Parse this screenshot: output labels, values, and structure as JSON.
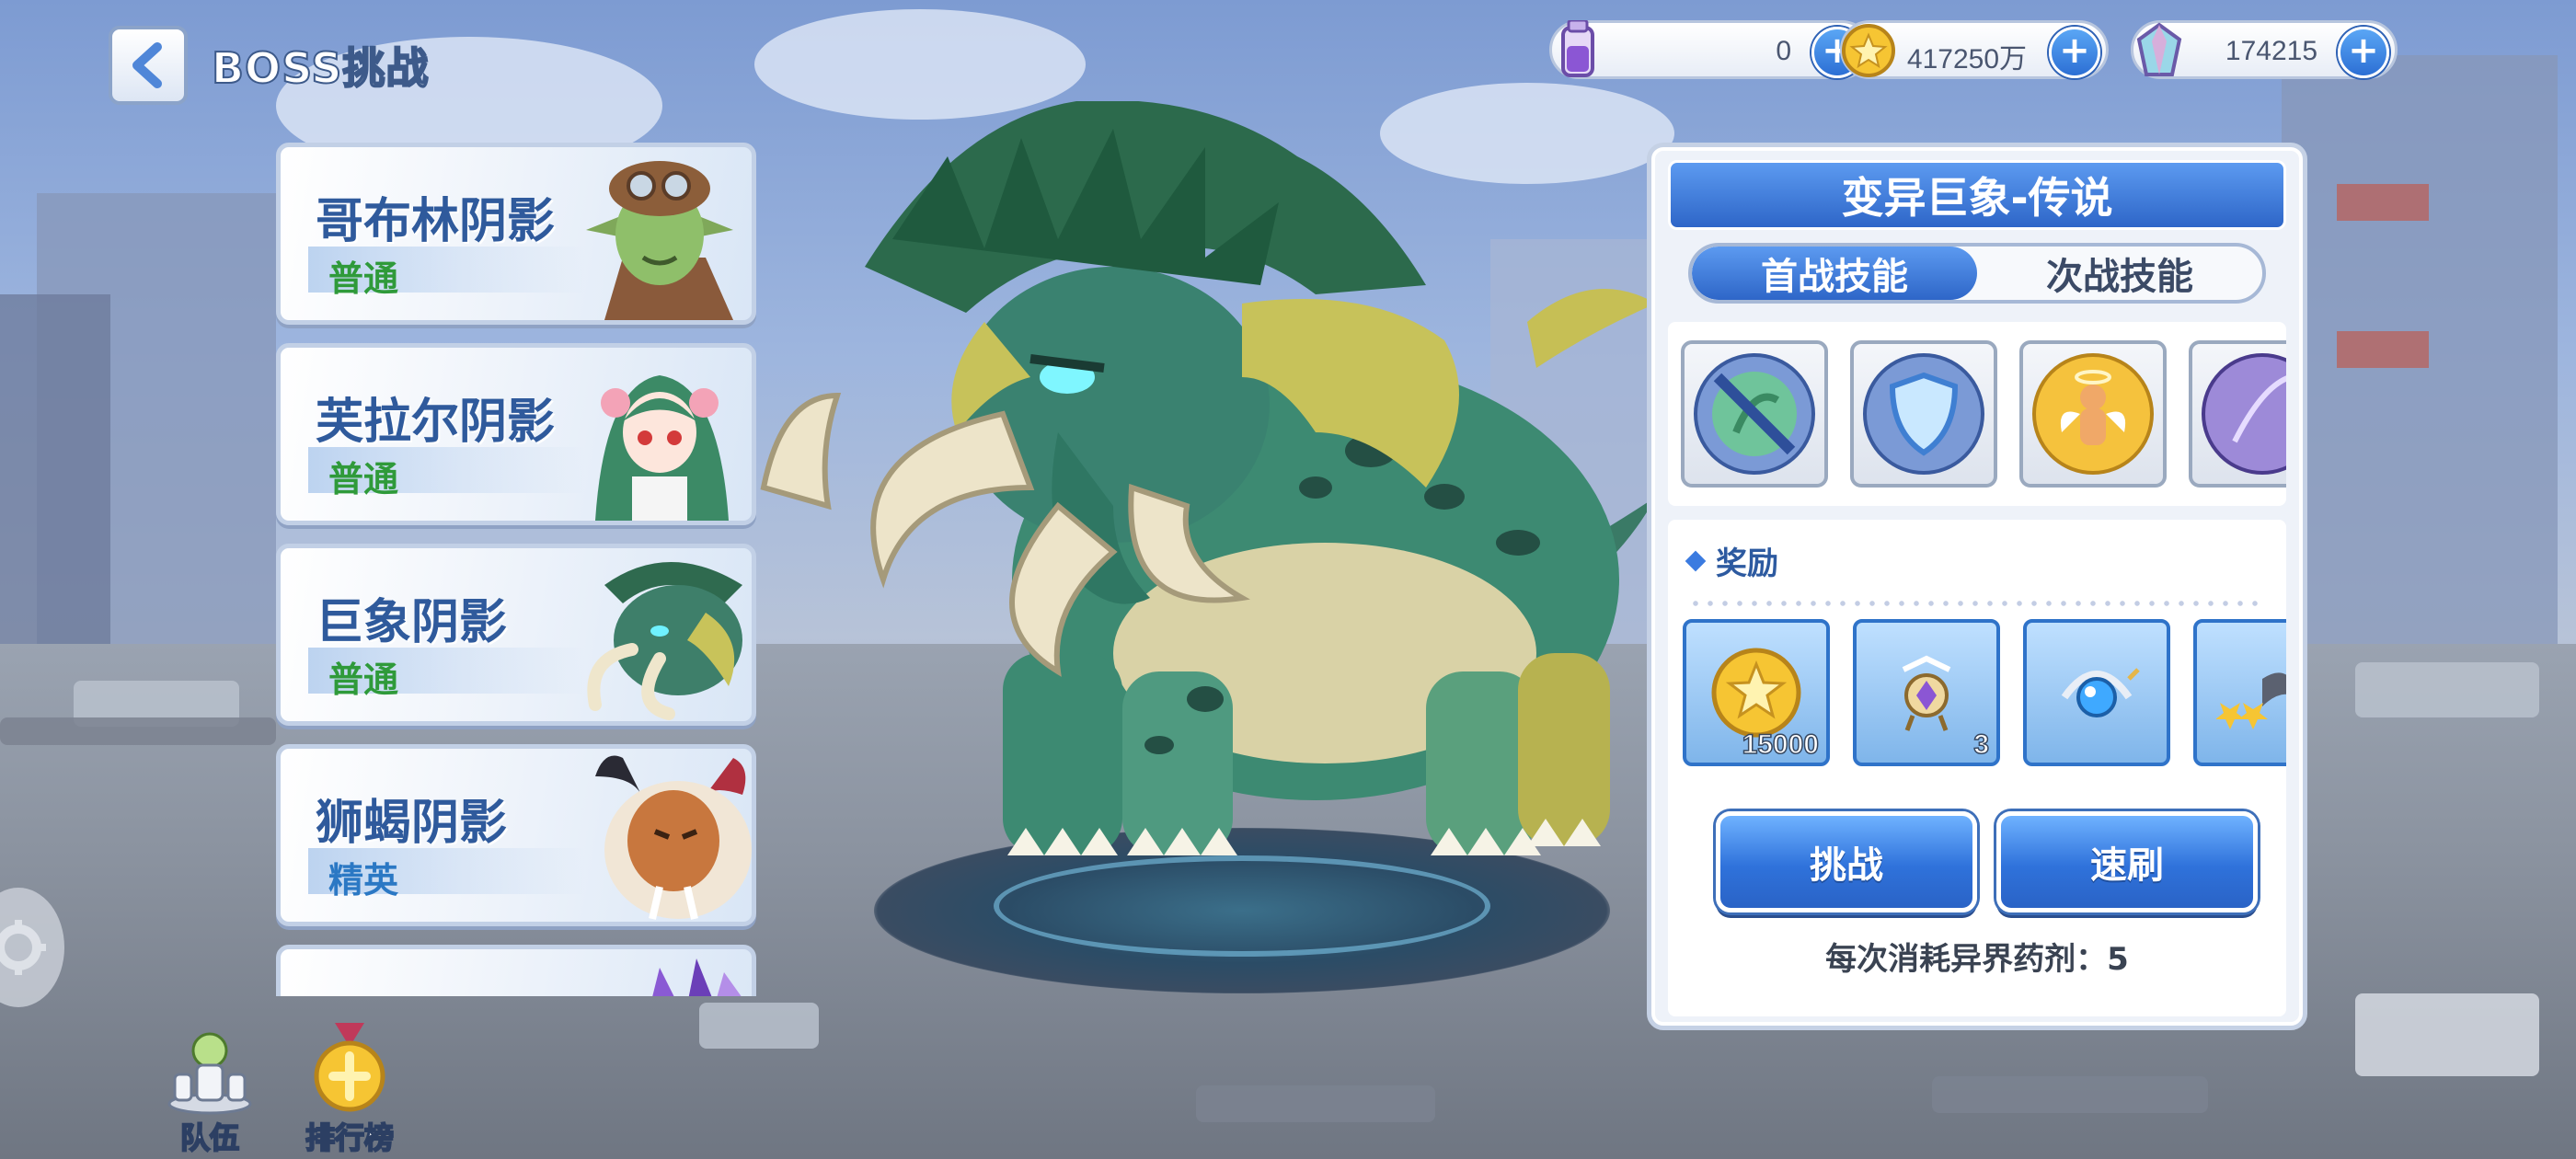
{
  "header": {
    "title": "BOSS挑战"
  },
  "resources": [
    {
      "name": "potion",
      "icon": "potion-bottle-icon",
      "value": "0"
    },
    {
      "name": "gold",
      "icon": "gold-star-coin-icon",
      "value": "417250万"
    },
    {
      "name": "crystal",
      "icon": "crystal-gem-icon",
      "value": "174215"
    }
  ],
  "boss_list": [
    {
      "name": "哥布林阴影",
      "rank": "普通",
      "portrait": "goblin-portrait-icon"
    },
    {
      "name": "芙拉尔阴影",
      "rank": "普通",
      "portrait": "green-haired-girl-portrait-icon"
    },
    {
      "name": "巨象阴影",
      "rank": "普通",
      "portrait": "mammoth-portrait-icon"
    },
    {
      "name": "狮蝎阴影",
      "rank": "精英",
      "portrait": "manticore-portrait-icon"
    },
    {
      "name": "",
      "rank": "",
      "portrait": "crystal-creature-portrait-icon"
    }
  ],
  "panel": {
    "title": "变异巨象-传说",
    "tabs": [
      "首战技能",
      "次战技能"
    ],
    "active_tab": "首战技能",
    "skills": [
      "no-heal-icon",
      "shield-icon",
      "angel-doll-icon",
      "purple-claw-icon"
    ],
    "reward_heading": "奖励",
    "rewards": [
      {
        "icon": "gold-coin-icon",
        "count": "15000"
      },
      {
        "icon": "purple-amulet-icon",
        "count": "3"
      },
      {
        "icon": "blue-orb-bow-icon",
        "count": ""
      },
      {
        "icon": "star-item-icon",
        "count": ""
      }
    ],
    "challenge_label": "挑战",
    "sweep_label": "速刷",
    "cost_note": "每次消耗异界药剂：5"
  },
  "bottom_buttons": [
    {
      "label": "队伍",
      "icon": "team-chess-icon"
    },
    {
      "label": "排行榜",
      "icon": "leaderboard-medal-icon"
    }
  ],
  "colors": {
    "accent_blue": "#2e66c8",
    "normal_rank": "#2f9a3a",
    "elite_rank": "#2b78c4",
    "boss_name": "#2f5a9c"
  }
}
